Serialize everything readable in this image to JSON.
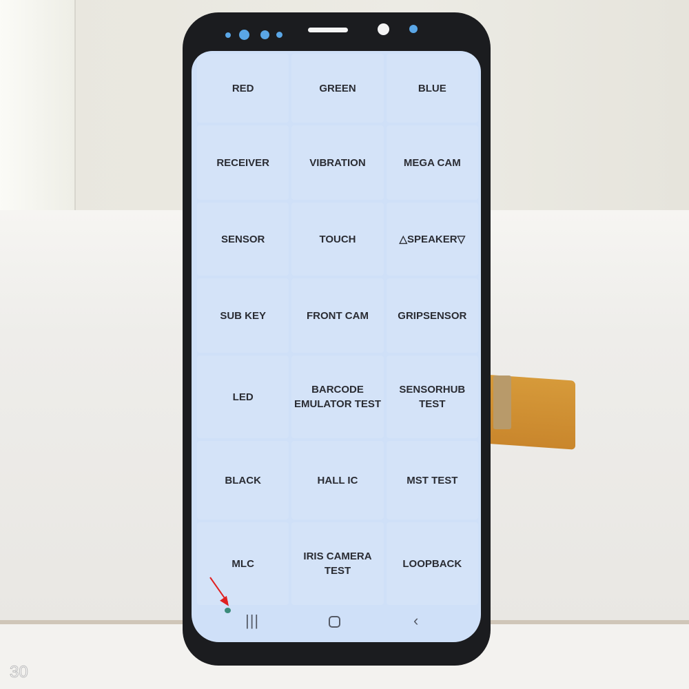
{
  "menu": {
    "items": [
      "RED",
      "GREEN",
      "BLUE",
      "RECEIVER",
      "VIBRATION",
      "MEGA CAM",
      "SENSOR",
      "TOUCH",
      "△SPEAKER▽",
      "SUB KEY",
      "FRONT CAM",
      "GRIPSENSOR",
      "LED",
      "BARCODE\nEMULATOR TEST",
      "SENSORHUB TEST",
      "BLACK",
      "HALL IC",
      "MST TEST",
      "MLC",
      "IRIS CAMERA\nTEST",
      "LOOPBACK"
    ]
  },
  "nav": {
    "recents_icon": "recents-icon",
    "home_icon": "home-icon",
    "back_icon": "back-icon"
  },
  "overlay": {
    "counter": "30",
    "annotation_color": "#e02020"
  },
  "colors": {
    "screen": "#cfe0f8",
    "button": "#d4e3f8",
    "text": "#2a2c33",
    "bezel": "#1b1c1f",
    "cable": "#d69a3a"
  }
}
